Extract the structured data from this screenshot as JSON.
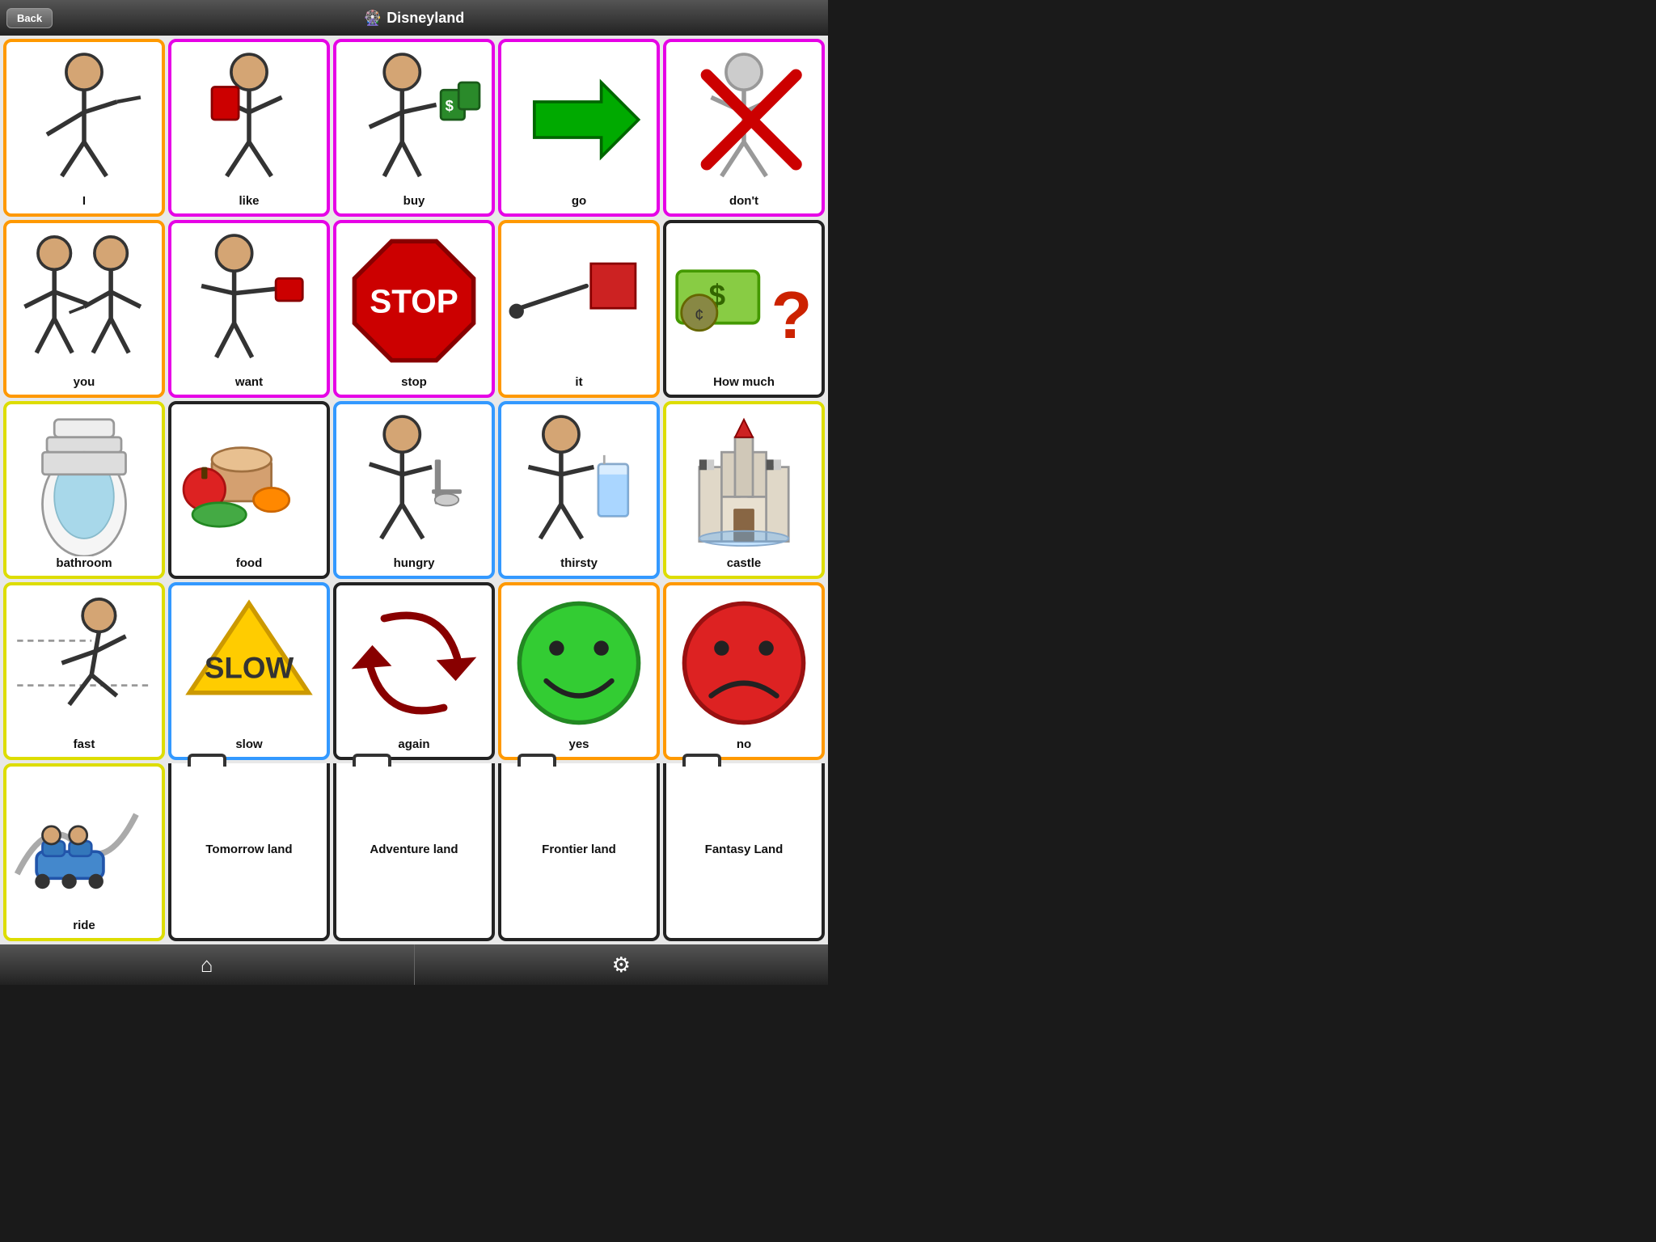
{
  "header": {
    "back_label": "Back",
    "title": "Disneyland",
    "icon": "🎡"
  },
  "grid": [
    [
      {
        "label": "I",
        "border": "orange",
        "icon": "person_point"
      },
      {
        "label": "like",
        "border": "magenta",
        "icon": "person_like"
      },
      {
        "label": "buy",
        "border": "magenta",
        "icon": "person_buy"
      },
      {
        "label": "go",
        "border": "magenta",
        "icon": "arrow_right"
      },
      {
        "label": "don't",
        "border": "magenta",
        "icon": "person_cross"
      }
    ],
    [
      {
        "label": "you",
        "border": "orange",
        "icon": "two_people"
      },
      {
        "label": "want",
        "border": "magenta",
        "icon": "person_want"
      },
      {
        "label": "stop",
        "border": "magenta",
        "icon": "stop_sign"
      },
      {
        "label": "it",
        "border": "orange",
        "icon": "point_square"
      },
      {
        "label": "How much",
        "border": "black",
        "icon": "money_question"
      }
    ],
    [
      {
        "label": "bathroom",
        "border": "yellow",
        "icon": "toilet"
      },
      {
        "label": "food",
        "border": "black",
        "icon": "food_items"
      },
      {
        "label": "hungry",
        "border": "blue",
        "icon": "person_hungry"
      },
      {
        "label": "thirsty",
        "border": "blue",
        "icon": "person_thirsty"
      },
      {
        "label": "castle",
        "border": "yellow",
        "icon": "castle"
      }
    ],
    [
      {
        "label": "fast",
        "border": "yellow",
        "icon": "person_run"
      },
      {
        "label": "slow",
        "border": "blue",
        "icon": "slow_sign"
      },
      {
        "label": "again",
        "border": "black",
        "icon": "arrows_again"
      },
      {
        "label": "yes",
        "border": "orange",
        "icon": "green_face"
      },
      {
        "label": "no",
        "border": "orange",
        "icon": "red_face"
      }
    ],
    [
      {
        "label": "ride",
        "border": "yellow",
        "icon": "roller_coaster"
      },
      {
        "label": "Tomorrow\nland",
        "border": "black",
        "folder": true
      },
      {
        "label": "Adventure\nland",
        "border": "black",
        "folder": true
      },
      {
        "label": "Frontier land",
        "border": "black",
        "folder": true
      },
      {
        "label": "Fantasy Land",
        "border": "black",
        "folder": true
      }
    ]
  ],
  "footer": {
    "home_icon": "⌂",
    "settings_icon": "⚙"
  }
}
